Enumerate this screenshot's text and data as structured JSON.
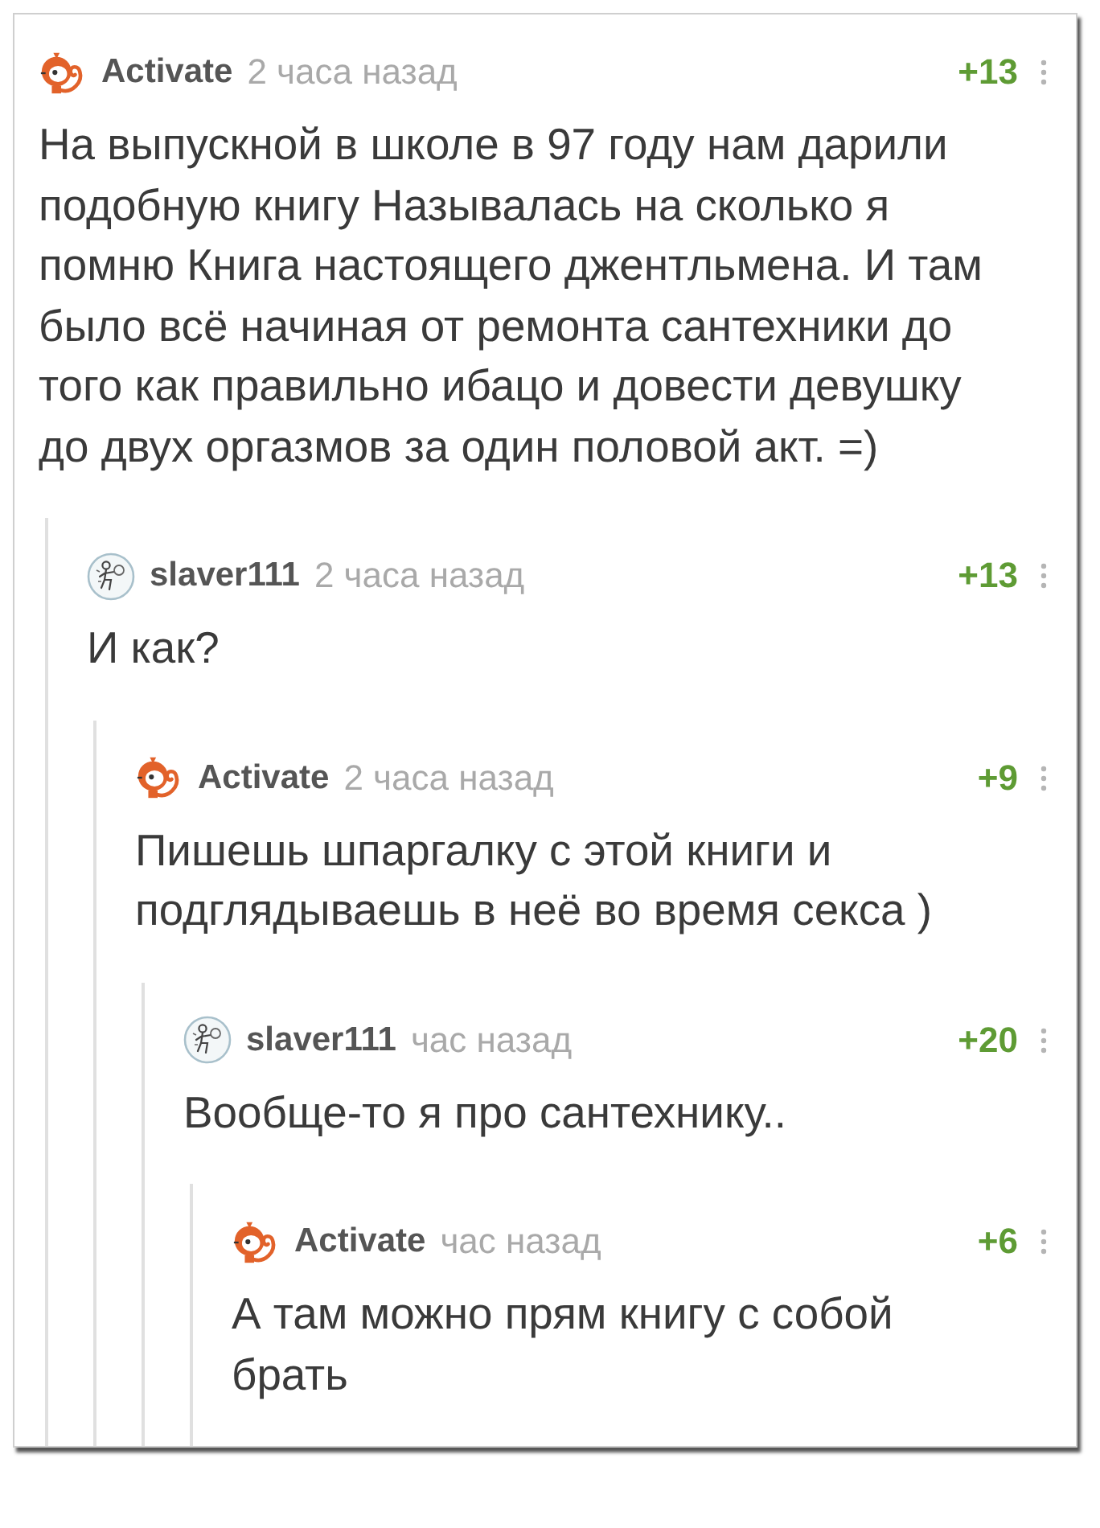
{
  "comments": [
    {
      "kind": "monkey",
      "author": "Activate",
      "time": "2 часа назад",
      "rating": "+13",
      "text": "На выпускной в школе в 97 году нам дарили подобную книгу Называлась на сколько я помню Книга настоящего джентльмена. И там было всё начиная от ремонта сантехники до того как правильно ибацо и довести девушку до двух оргазмов за один половой акт. =)",
      "children": [
        {
          "kind": "sketch",
          "author": "slaver111",
          "time": "2 часа назад",
          "rating": "+13",
          "text": "И как?",
          "children": [
            {
              "kind": "monkey",
              "author": "Activate",
              "time": "2 часа назад",
              "rating": "+9",
              "text": "Пишешь шпаргалку с этой книги и подглядываешь в неё во время секса )",
              "children": [
                {
                  "kind": "sketch",
                  "author": "slaver111",
                  "time": "час назад",
                  "rating": "+20",
                  "text": "Вообще-то я про сантехнику..",
                  "children": [
                    {
                      "kind": "monkey",
                      "author": "Activate",
                      "time": "час назад",
                      "rating": "+6",
                      "text": "А там можно прям книгу с собой брать"
                    }
                  ]
                }
              ]
            }
          ]
        }
      ]
    }
  ]
}
